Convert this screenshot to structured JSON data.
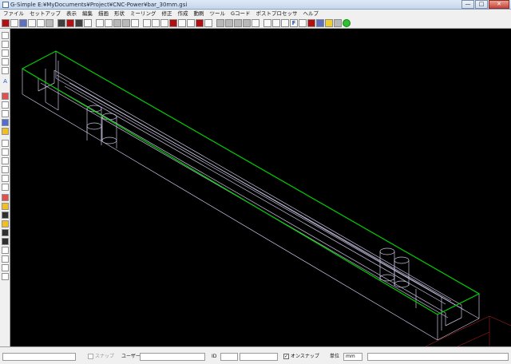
{
  "window": {
    "title": "G-Simple E:¥MyDocuments¥Project¥CNC-Power¥bar_30mm.gsi",
    "minimize": "—",
    "maximize": "□",
    "close": "✕"
  },
  "menu": {
    "items": [
      "ファイル",
      "セットアップ",
      "表示",
      "編集",
      "描画",
      "形状",
      "ミーリング",
      "修正",
      "作成",
      "動刷",
      "ツール",
      "Gコード",
      "ポストプロセッサ",
      "ヘルプ"
    ]
  },
  "colors": {
    "background": "#000000",
    "outline_selected": "#00d000",
    "geometry": "#c8c0e0",
    "axis": "#b02020"
  },
  "statusbar": {
    "snap_label": "スナップ",
    "user_label": "ユーザー",
    "id_label": "ID",
    "osnap_label": "オンスナップ",
    "osnap_checked": "✓",
    "unit_label": "単位",
    "unit_value": "mm"
  }
}
